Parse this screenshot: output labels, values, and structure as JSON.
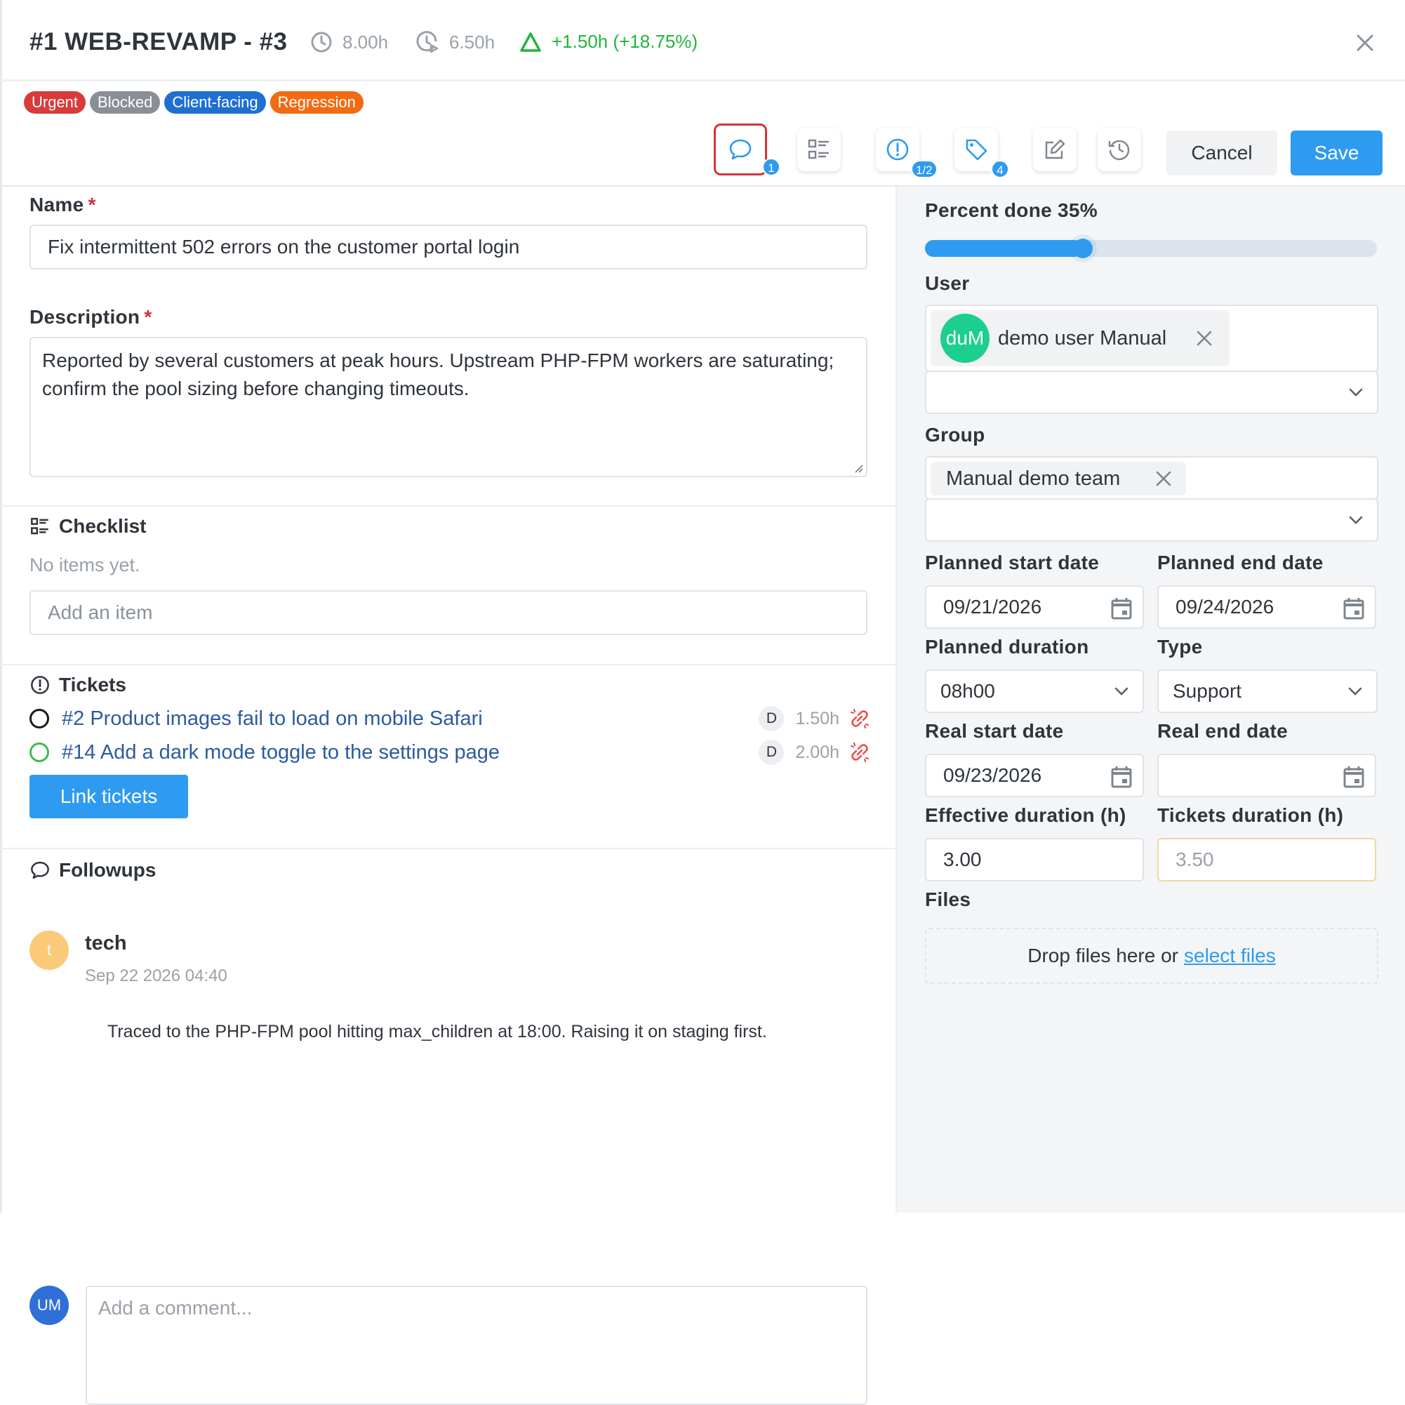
{
  "header": {
    "title": "#1 WEB-REVAMP - #3",
    "estimate": "8.00h",
    "actual": "6.50h",
    "difference": "+1.50h (+18.75%)"
  },
  "tags": [
    {
      "label": "Urgent",
      "color": "#d93a3a"
    },
    {
      "label": "Blocked",
      "color": "#8a8f95"
    },
    {
      "label": "Client-facing",
      "color": "#1f6fd1"
    },
    {
      "label": "Regression",
      "color": "#f26b12"
    }
  ],
  "toolbar": {
    "followups_badge": "1",
    "tickets_badge": "1/2",
    "tags_badge": "4",
    "cancel_label": "Cancel",
    "save_label": "Save"
  },
  "form": {
    "name_label": "Name",
    "name_value": "Fix intermittent 502 errors on the customer portal login",
    "description_label": "Description",
    "description_value": "Reported by several customers at peak hours. Upstream PHP-FPM workers are saturating; confirm the pool sizing before changing timeouts.",
    "required_mark": "*"
  },
  "checklist": {
    "title": "Checklist",
    "empty_text": "No items yet.",
    "add_placeholder": "Add an item"
  },
  "tickets": {
    "title": "Tickets",
    "items": [
      {
        "link": "#2 Product images fail to load on mobile Safari",
        "assignee": "D",
        "hours": "1.50h",
        "status": "open"
      },
      {
        "link": "#14 Add a dark mode toggle to the settings page",
        "assignee": "D",
        "hours": "2.00h",
        "status": "new"
      }
    ],
    "link_button": "Link tickets"
  },
  "followups": {
    "title": "Followups",
    "items": [
      {
        "avatar": "t",
        "user": "tech",
        "date": "Sep 22 2026 04:40",
        "text": "Traced to the PHP-FPM pool hitting max_children at 18:00. Raising it on staging first."
      }
    ],
    "current_user_avatar": "UM",
    "comment_placeholder": "Add a comment..."
  },
  "side": {
    "percent_label": "Percent done 35%",
    "percent_value": 0.35,
    "user_label": "User",
    "user_avatar": "duM",
    "user_name": "demo user Manual",
    "group_label": "Group",
    "group_name": "Manual demo team",
    "planned_start_label": "Planned start date",
    "planned_start_value": "09/21/2026",
    "planned_end_label": "Planned end date",
    "planned_end_value": "09/24/2026",
    "planned_duration_label": "Planned duration",
    "planned_duration_value": "08h00",
    "type_label": "Type",
    "type_value": "Support",
    "real_start_label": "Real start date",
    "real_start_value": "09/23/2026",
    "real_end_label": "Real end date",
    "real_end_value": "",
    "effective_label": "Effective duration (h)",
    "effective_value": "3.00",
    "tickets_duration_label": "Tickets duration (h)",
    "tickets_duration_value": "3.50",
    "files_label": "Files",
    "drop_text": "Drop files here or",
    "select_files": "select files"
  },
  "colors": {
    "accent": "#2e9bf0",
    "success": "#22b43c",
    "danger": "#d3333b",
    "user_avatar": "#1ccf8f",
    "tech_avatar": "#fbc97a",
    "me_avatar": "#2e6fd8"
  }
}
